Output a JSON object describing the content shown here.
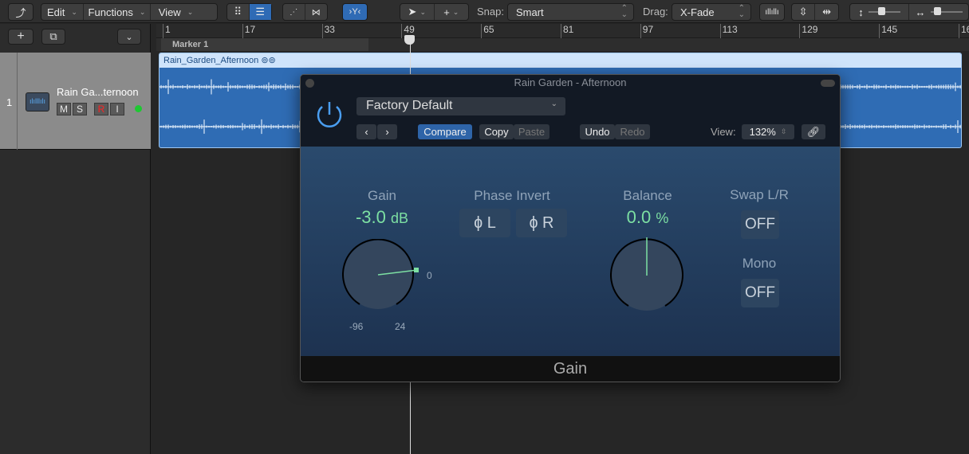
{
  "toolbar": {
    "edit": "Edit",
    "functions": "Functions",
    "view": "View",
    "snap_label": "Snap:",
    "snap_value": "Smart",
    "drag_label": "Drag:",
    "drag_value": "X-Fade"
  },
  "ruler": {
    "bars": [
      "1",
      "17",
      "33",
      "49",
      "65",
      "81",
      "97",
      "113",
      "129",
      "145",
      "16"
    ],
    "marker": "Marker 1"
  },
  "track": {
    "number": "1",
    "name": "Rain Ga...ternoon",
    "mute": "M",
    "solo": "S",
    "record": "R",
    "input": "I"
  },
  "region": {
    "name": "Rain_Garden_Afternoon"
  },
  "plugin": {
    "title": "Rain Garden - Afternoon",
    "preset": "Factory Default",
    "compare": "Compare",
    "copy": "Copy",
    "paste": "Paste",
    "undo": "Undo",
    "redo": "Redo",
    "view_label": "View:",
    "view_value": "132%",
    "gain_label": "Gain",
    "gain_value": "-3.0",
    "gain_unit": "dB",
    "gain_min": "-96",
    "gain_max": "24",
    "gain_zero": "0",
    "phase_label": "Phase Invert",
    "phase_l": "L",
    "phase_r": "R",
    "balance_label": "Balance",
    "balance_value": "0.0",
    "balance_unit": "%",
    "swap_label": "Swap L/R",
    "swap_value": "OFF",
    "mono_label": "Mono",
    "mono_value": "OFF",
    "footer": "Gain"
  },
  "colors": {
    "accent": "#2f6bb5",
    "value_green": "#7de0a3",
    "region_blue": "#2f6cb4"
  }
}
